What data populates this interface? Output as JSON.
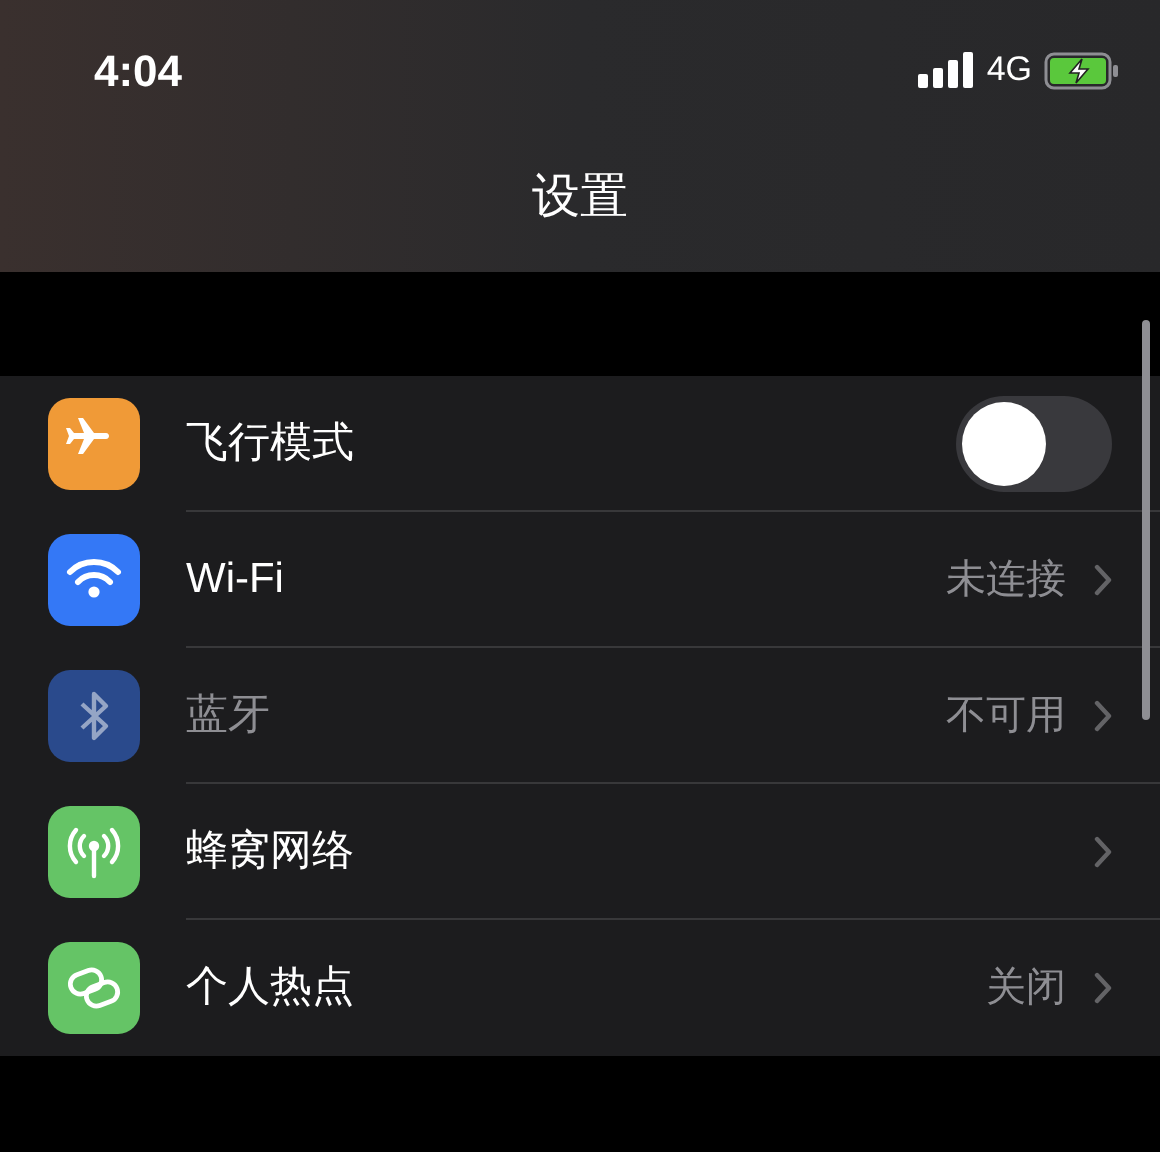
{
  "status_bar": {
    "time": "4:04",
    "network": "4G"
  },
  "title": "设置",
  "rows": [
    {
      "kind": "toggle",
      "color": "#f09a37",
      "label": "飞行模式",
      "on": false,
      "disabled": false
    },
    {
      "kind": "link",
      "color": "#3478f6",
      "label": "Wi-Fi",
      "value": "未连接",
      "disabled": false
    },
    {
      "kind": "link",
      "color": "#2a4a8c",
      "label": "蓝牙",
      "value": "不可用",
      "disabled": true
    },
    {
      "kind": "link",
      "color": "#65c466",
      "label": "蜂窝网络",
      "disabled": false
    },
    {
      "kind": "link",
      "color": "#65c466",
      "label": "个人热点",
      "value": "关闭",
      "disabled": false
    }
  ]
}
